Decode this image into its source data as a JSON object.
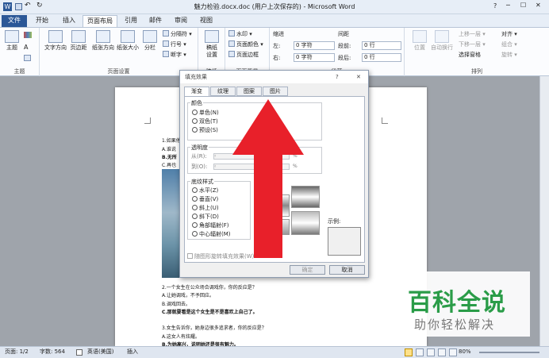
{
  "window": {
    "title": "魅力检验.docx.doc (用户上次保存的) - Microsoft Word",
    "help": "?",
    "min": "─",
    "max": "☐",
    "close": "✕"
  },
  "tabs": [
    "文件",
    "开始",
    "插入",
    "页面布局",
    "引用",
    "邮件",
    "审阅",
    "视图"
  ],
  "ribbon": {
    "theme": {
      "label": "主题",
      "group": "主题"
    },
    "page_setup": {
      "items": [
        "文字方向",
        "页边距",
        "纸张方向",
        "纸张大小",
        "分栏"
      ],
      "small": [
        "分隔符 ▾",
        "行号 ▾",
        "断字 ▾"
      ],
      "group": "页面设置"
    },
    "draft": {
      "label": "稿纸\n设置",
      "group": "稿纸"
    },
    "background": {
      "items": [
        "水印 ▾",
        "页面颜色 ▾",
        "页面边框"
      ],
      "group": "页面背景"
    },
    "indent": {
      "title": "缩进",
      "left_label": "左:",
      "left_val": "0 字符",
      "right_label": "右:",
      "right_val": "0 字符"
    },
    "spacing": {
      "title": "间距",
      "before_label": "段前:",
      "before_val": "0 行",
      "after_label": "段后:",
      "after_val": "0 行"
    },
    "paragraph_group": "段落",
    "arrange": {
      "items": [
        "位置",
        "自动换行"
      ],
      "small": [
        "上移一层 ▾",
        "下移一层 ▾",
        "选择窗格",
        "对齐 ▾",
        "组合 ▾",
        "旋转 ▾"
      ],
      "group": "排列"
    }
  },
  "document": {
    "lines": [
      "1.如果他",
      "A.谁说",
      "B.无所",
      "C.再也",
      "2.一个女生在公众场合调戏你，你的反应是？",
      "A.让她调戏，不予回应。",
      "B.调戏回去。",
      "C.那就要看是这个女生是不是喜欢上自己了。",
      "3.女生告诉你，她身边很多追求者，你的反应是？",
      "A.这女人有炫耀。",
      "B.为她高兴，说明她还是很有魅力。"
    ]
  },
  "dialog": {
    "title": "填充效果",
    "help": "?",
    "close": "✕",
    "tabs": [
      "渐变",
      "纹理",
      "图案",
      "图片"
    ],
    "colors": {
      "title": "颜色",
      "options": [
        "单色(N)",
        "双色(T)",
        "预设(S)"
      ]
    },
    "transparency": {
      "title": "透明度",
      "from": "从(R):",
      "to": "到(O):",
      "pct": "%"
    },
    "shading": {
      "title": "底纹样式",
      "options": [
        "水平(Z)",
        "垂直(V)",
        "斜上(U)",
        "斜下(D)",
        "角部辐射(F)",
        "中心辐射(M)"
      ]
    },
    "sample": "示例:",
    "rotate": "随图形旋转填充效果(W)",
    "ok": "确定",
    "cancel": "取消"
  },
  "status": {
    "page": "页面: 1/2",
    "words": "字数: 564",
    "lang": "英语(美国)",
    "mode": "插入",
    "zoom": "80%"
  },
  "watermark": {
    "main": "百科全说",
    "sub": "助你轻松解决"
  },
  "colors": {
    "arrow": "#e8202a",
    "file_tab": "#2b5797",
    "watermark_green": "#2a9c48"
  }
}
